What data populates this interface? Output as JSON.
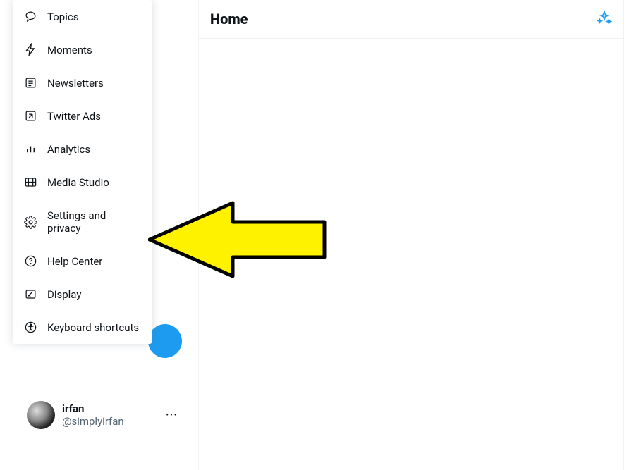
{
  "menu": {
    "items": [
      {
        "label": "Topics",
        "icon": "topics"
      },
      {
        "label": "Moments",
        "icon": "moments"
      },
      {
        "label": "Newsletters",
        "icon": "newsletters"
      },
      {
        "label": "Twitter Ads",
        "icon": "ads"
      },
      {
        "label": "Analytics",
        "icon": "analytics"
      },
      {
        "label": "Media Studio",
        "icon": "media"
      },
      {
        "label": "Settings and privacy",
        "icon": "settings"
      },
      {
        "label": "Help Center",
        "icon": "help"
      },
      {
        "label": "Display",
        "icon": "display"
      },
      {
        "label": "Keyboard shortcuts",
        "icon": "keyboard"
      }
    ]
  },
  "header": {
    "title": "Home"
  },
  "profile": {
    "name": "irfan",
    "handle": "@simplyirfan"
  },
  "annotation": {
    "target": "Settings and privacy"
  }
}
